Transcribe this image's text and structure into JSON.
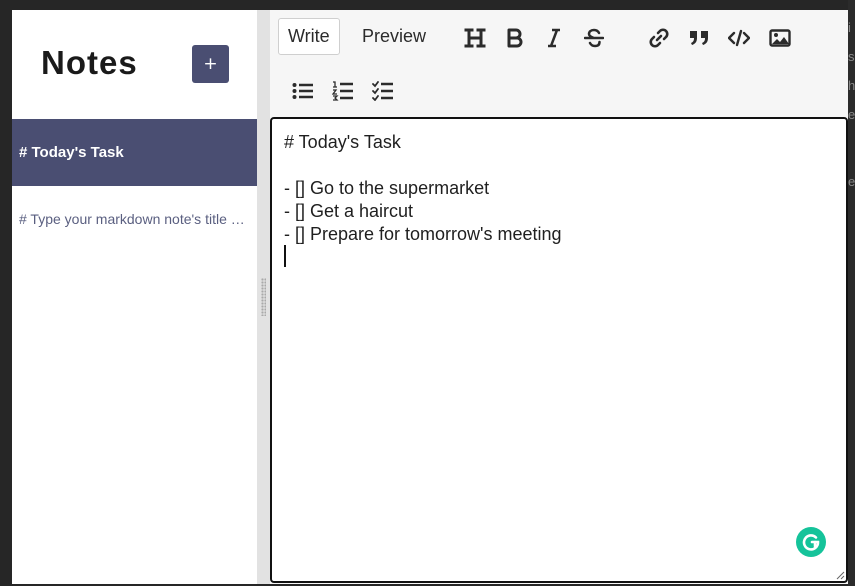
{
  "background_text": [
    "i",
    "s",
    "h",
    "e",
    "e"
  ],
  "sidebar": {
    "title": "Notes",
    "new_note_label": "+",
    "notes": [
      {
        "title": "# Today's Task",
        "active": true
      },
      {
        "title": "# Type your markdown note's title here",
        "active": false
      }
    ]
  },
  "editor": {
    "tabs": [
      {
        "label": "Write",
        "selected": true
      },
      {
        "label": "Preview",
        "selected": false
      }
    ],
    "toolbar_icons": [
      "header-icon",
      "bold-icon",
      "italic-icon",
      "strikethrough-icon",
      "link-icon",
      "quote-icon",
      "code-icon",
      "image-icon",
      "unordered-list-icon",
      "ordered-list-icon",
      "checklist-icon"
    ],
    "content_lines": [
      "# Today's Task",
      "",
      "- [] Go to the supermarket",
      "- [] Get a haircut",
      "- [] Prepare for tomorrow's meeting"
    ]
  },
  "colors": {
    "accent": "#4a4e72",
    "grammarly": "#15c39a"
  }
}
